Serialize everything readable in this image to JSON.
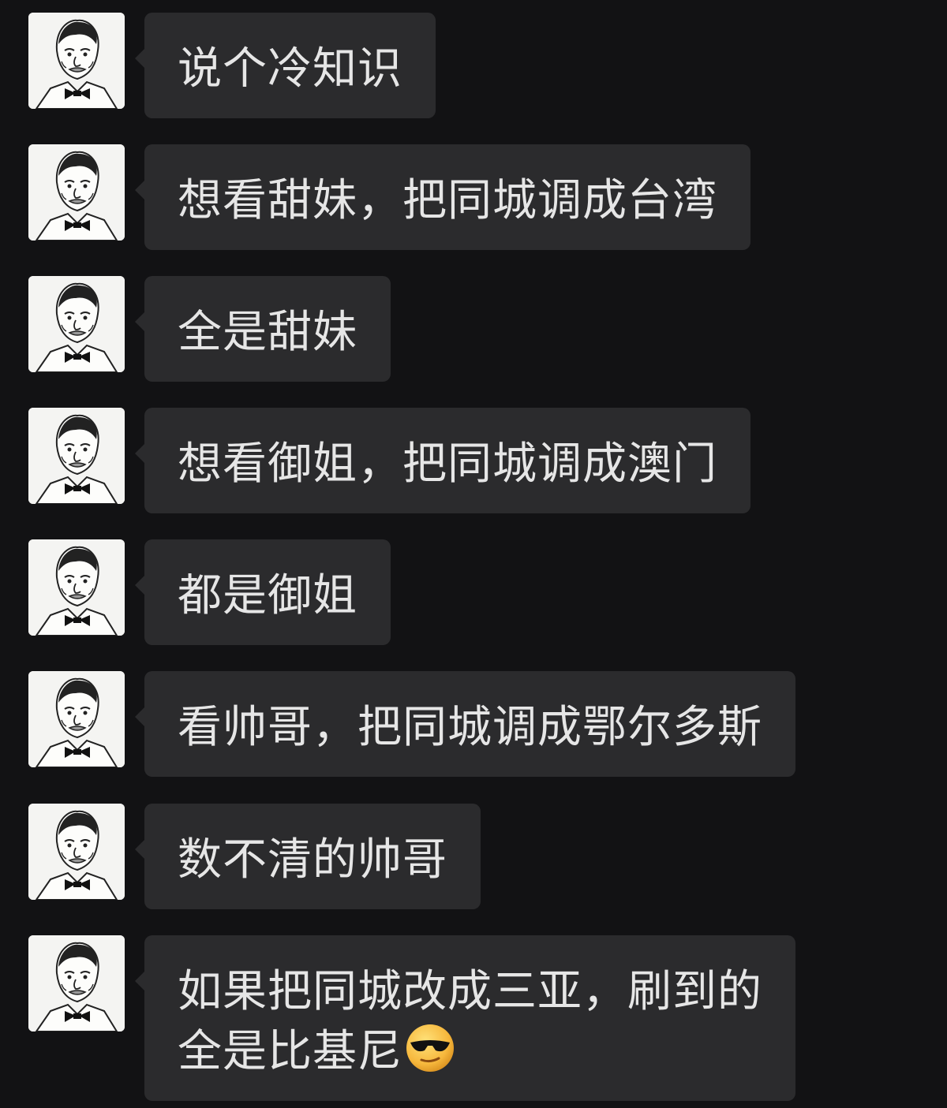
{
  "messages": [
    {
      "lines": [
        "说个冷知识"
      ]
    },
    {
      "lines": [
        "想看甜妹，把同城调成台湾"
      ]
    },
    {
      "lines": [
        "全是甜妹"
      ]
    },
    {
      "lines": [
        "想看御姐，把同城调成澳门"
      ]
    },
    {
      "lines": [
        "都是御姐"
      ]
    },
    {
      "lines": [
        "看帅哥，把同城调成鄂尔多斯"
      ]
    },
    {
      "lines": [
        "数不清的帅哥"
      ]
    },
    {
      "lines": [
        "如果把同城改成三亚，刷到的",
        "全是比基尼"
      ],
      "emoji": "sunglasses-emoji"
    }
  ],
  "colors": {
    "background": "#121214",
    "bubble": "#2b2b2d",
    "text": "#e6e6e6"
  }
}
